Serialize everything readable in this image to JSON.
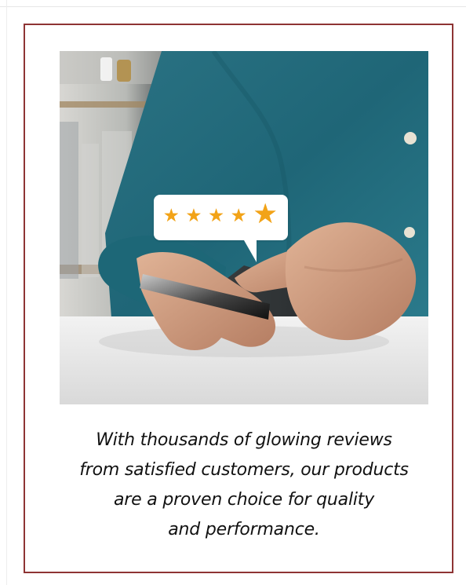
{
  "card": {
    "border_color": "#8e3434",
    "image": {
      "subject": "person holding phone with review bubble",
      "rating": 5,
      "star_color": "#f2a318"
    },
    "caption_lines": [
      "With thousands of glowing reviews",
      "from satisfied customers, our products",
      "are a proven choice for quality",
      "and performance."
    ]
  }
}
